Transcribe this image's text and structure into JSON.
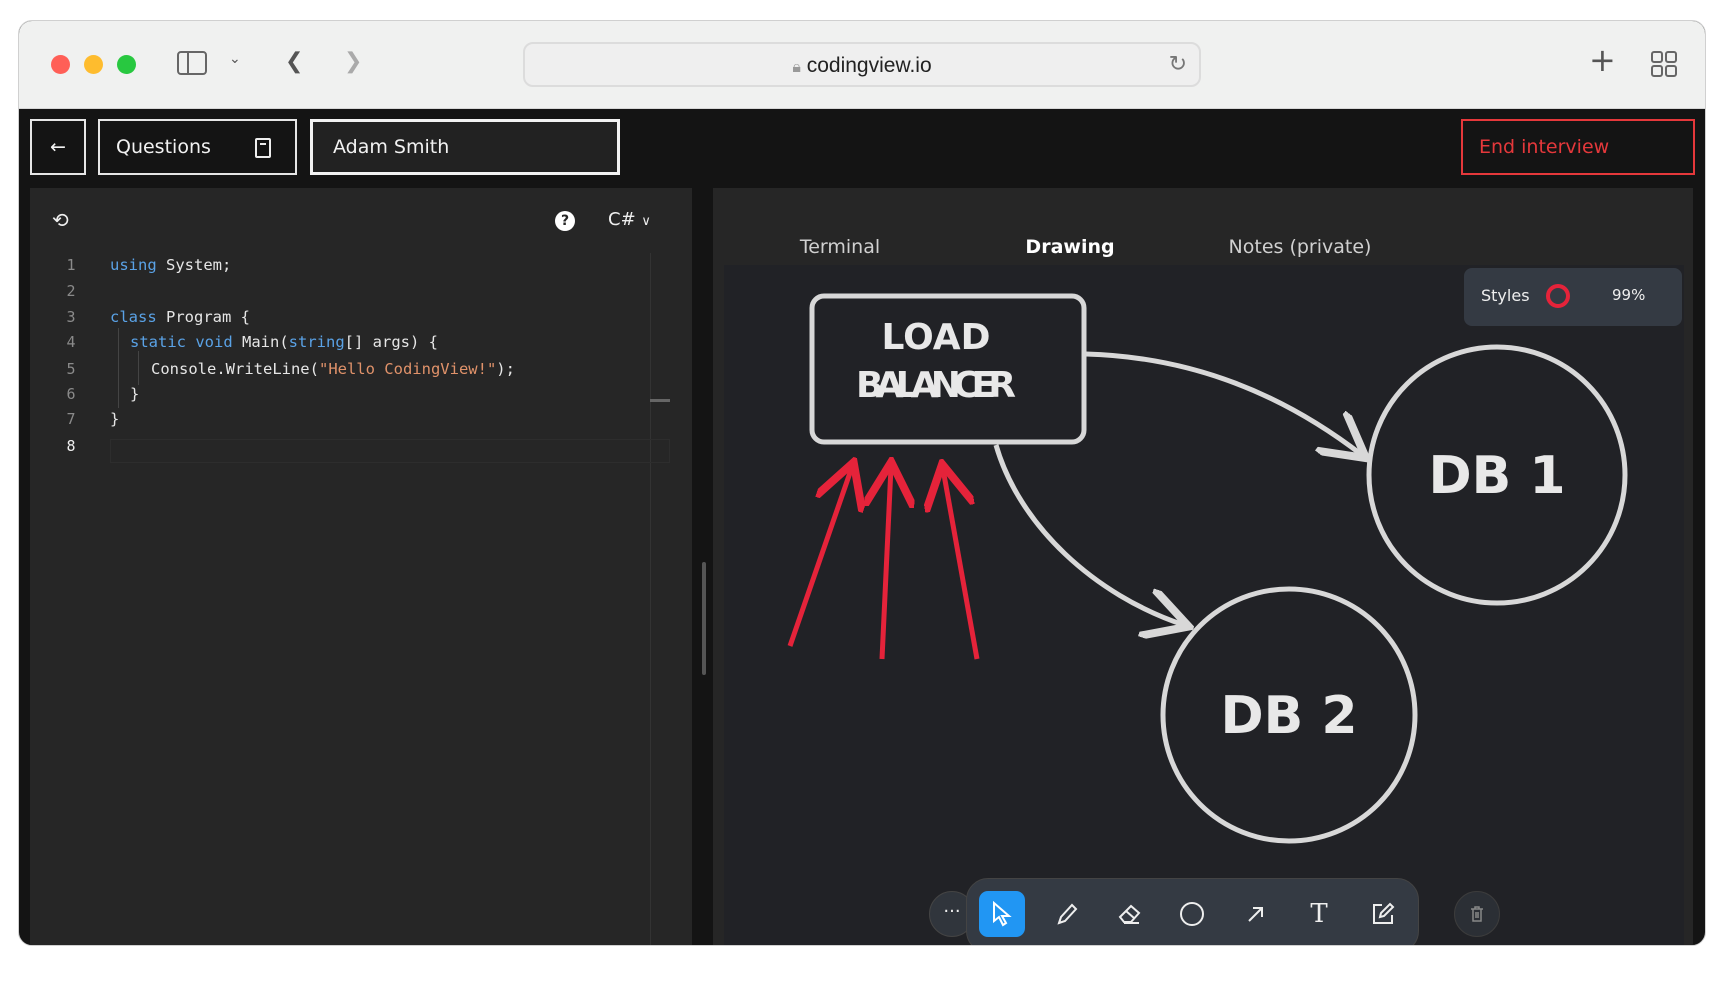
{
  "browser": {
    "url": "codingview.io",
    "lights": [
      "#ff5f57",
      "#febc2e",
      "#28c840"
    ]
  },
  "header": {
    "back_label": "←",
    "questions_label": "Questions",
    "candidate_name": "Adam Smith",
    "end_label": "End interview",
    "end_color": "#e5383b"
  },
  "editor": {
    "language": "C#",
    "lines": [
      {
        "n": "1"
      },
      {
        "n": "2"
      },
      {
        "n": "3"
      },
      {
        "n": "4"
      },
      {
        "n": "5"
      },
      {
        "n": "6"
      },
      {
        "n": "7"
      },
      {
        "n": "8"
      }
    ],
    "code": {
      "l1a": "using",
      "l1b": " System;",
      "l3a": "class",
      "l3b": " Program {",
      "l4a": "static void",
      "l4b": " Main(",
      "l4c": "string",
      "l4d": "[] args) {",
      "l5a": "Console.WriteLine(",
      "l5b": "\"Hello CodingView!\"",
      "l5c": ");",
      "l6": "}",
      "l7": "}"
    }
  },
  "tabs": [
    {
      "label": "Terminal"
    },
    {
      "label": "Drawing",
      "active": true
    },
    {
      "label": "Notes (private)"
    }
  ],
  "styles_panel": {
    "label": "Styles",
    "stroke_color": "#e5233a",
    "zoom": "99%"
  },
  "drawing": {
    "box_line1": "LOAD",
    "box_line2": "BALANCER",
    "db1": "DB 1",
    "db2": "DB 2"
  },
  "toolbar": {
    "active_color": "#2196f3",
    "tools": [
      "select",
      "pencil",
      "eraser",
      "ellipse",
      "arrow",
      "text",
      "note"
    ]
  }
}
